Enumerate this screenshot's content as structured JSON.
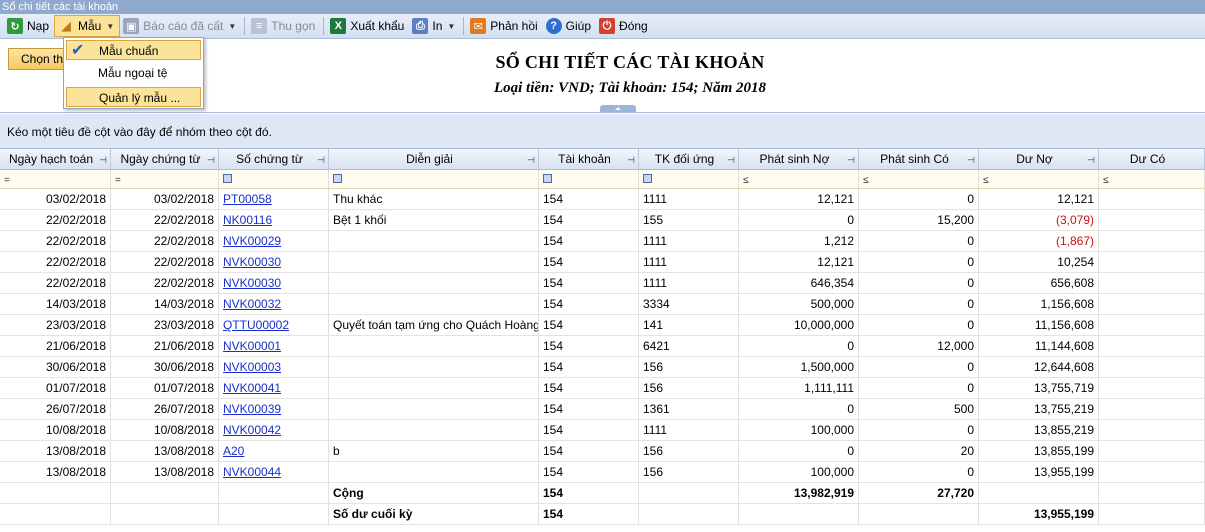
{
  "window": {
    "title": "Sổ chi tiết các tài khoản"
  },
  "toolbar": {
    "nap": "Nạp",
    "mau": "Mẫu",
    "bao_cao_da_cat": "Báo cáo đã cất",
    "thu_gon": "Thu gọn",
    "xuat_khau": "Xuất khẩu",
    "in": "In",
    "phan_hoi": "Phản hồi",
    "giup": "Giúp",
    "dong": "Đóng"
  },
  "template_menu": {
    "items": [
      "Mẫu chuẩn",
      "Mẫu ngoại tệ",
      "Quản lý mẫu ..."
    ]
  },
  "header": {
    "choose_button": "Chọn tham số",
    "title": "SỔ CHI TIẾT CÁC TÀI KHOẢN",
    "subtitle": "Loại tiền: VND; Tài khoản: 154; Năm 2018"
  },
  "group_panel": {
    "hint": "Kéo một tiêu đề cột vào đây để nhóm theo cột đó."
  },
  "grid": {
    "columns": [
      "Ngày hạch toán",
      "Ngày chứng từ",
      "Số chứng từ",
      "Diễn giải",
      "Tài khoản",
      "TK đối ứng",
      "Phát sinh Nợ",
      "Phát sinh Có",
      "Dư Nợ",
      "Dư Có"
    ],
    "filter_ops": [
      "=",
      "=",
      "",
      "",
      "",
      "",
      "≤",
      "≤",
      "≤",
      "≤"
    ],
    "rows": [
      [
        "03/02/2018",
        "03/02/2018",
        "PT00058",
        "Thu khác",
        "154",
        "1111",
        "12,121",
        "0",
        "12,121",
        ""
      ],
      [
        "22/02/2018",
        "22/02/2018",
        "NK00116",
        "Bệt 1 khối",
        "154",
        "155",
        "0",
        "15,200",
        "(3,079)",
        ""
      ],
      [
        "22/02/2018",
        "22/02/2018",
        "NVK00029",
        "",
        "154",
        "1111",
        "1,212",
        "0",
        "(1,867)",
        ""
      ],
      [
        "22/02/2018",
        "22/02/2018",
        "NVK00030",
        "",
        "154",
        "1111",
        "12,121",
        "0",
        "10,254",
        ""
      ],
      [
        "22/02/2018",
        "22/02/2018",
        "NVK00030",
        "",
        "154",
        "1111",
        "646,354",
        "0",
        "656,608",
        ""
      ],
      [
        "14/03/2018",
        "14/03/2018",
        "NVK00032",
        "",
        "154",
        "3334",
        "500,000",
        "0",
        "1,156,608",
        ""
      ],
      [
        "23/03/2018",
        "23/03/2018",
        "QTTU00002",
        "Quyết toán tạm ứng cho Quách Hoàng",
        "154",
        "141",
        "10,000,000",
        "0",
        "11,156,608",
        ""
      ],
      [
        "21/06/2018",
        "21/06/2018",
        "NVK00001",
        "",
        "154",
        "6421",
        "0",
        "12,000",
        "11,144,608",
        ""
      ],
      [
        "30/06/2018",
        "30/06/2018",
        "NVK00003",
        "",
        "154",
        "156",
        "1,500,000",
        "0",
        "12,644,608",
        ""
      ],
      [
        "01/07/2018",
        "01/07/2018",
        "NVK00041",
        "",
        "154",
        "156",
        "1,111,111",
        "0",
        "13,755,719",
        ""
      ],
      [
        "26/07/2018",
        "26/07/2018",
        "NVK00039",
        "",
        "154",
        "1361",
        "0",
        "500",
        "13,755,219",
        ""
      ],
      [
        "10/08/2018",
        "10/08/2018",
        "NVK00042",
        "",
        "154",
        "1111",
        "100,000",
        "0",
        "13,855,219",
        ""
      ],
      [
        "13/08/2018",
        "13/08/2018",
        "A20",
        "b",
        "154",
        "156",
        "0",
        "20",
        "13,855,199",
        ""
      ],
      [
        "13/08/2018",
        "13/08/2018",
        "NVK00044",
        "",
        "154",
        "156",
        "100,000",
        "0",
        "13,955,199",
        ""
      ]
    ],
    "total": {
      "label": "Cộng",
      "account": "154",
      "debit": "13,982,919",
      "credit": "27,720"
    },
    "closing": {
      "label": "Số dư cuối kỳ",
      "account": "154",
      "balance": "13,955,199"
    }
  },
  "colors": {
    "accent": "#fbe39a",
    "link": "#1b2fcc",
    "negative": "#d01010",
    "header_bg": "#d8e2f1"
  }
}
